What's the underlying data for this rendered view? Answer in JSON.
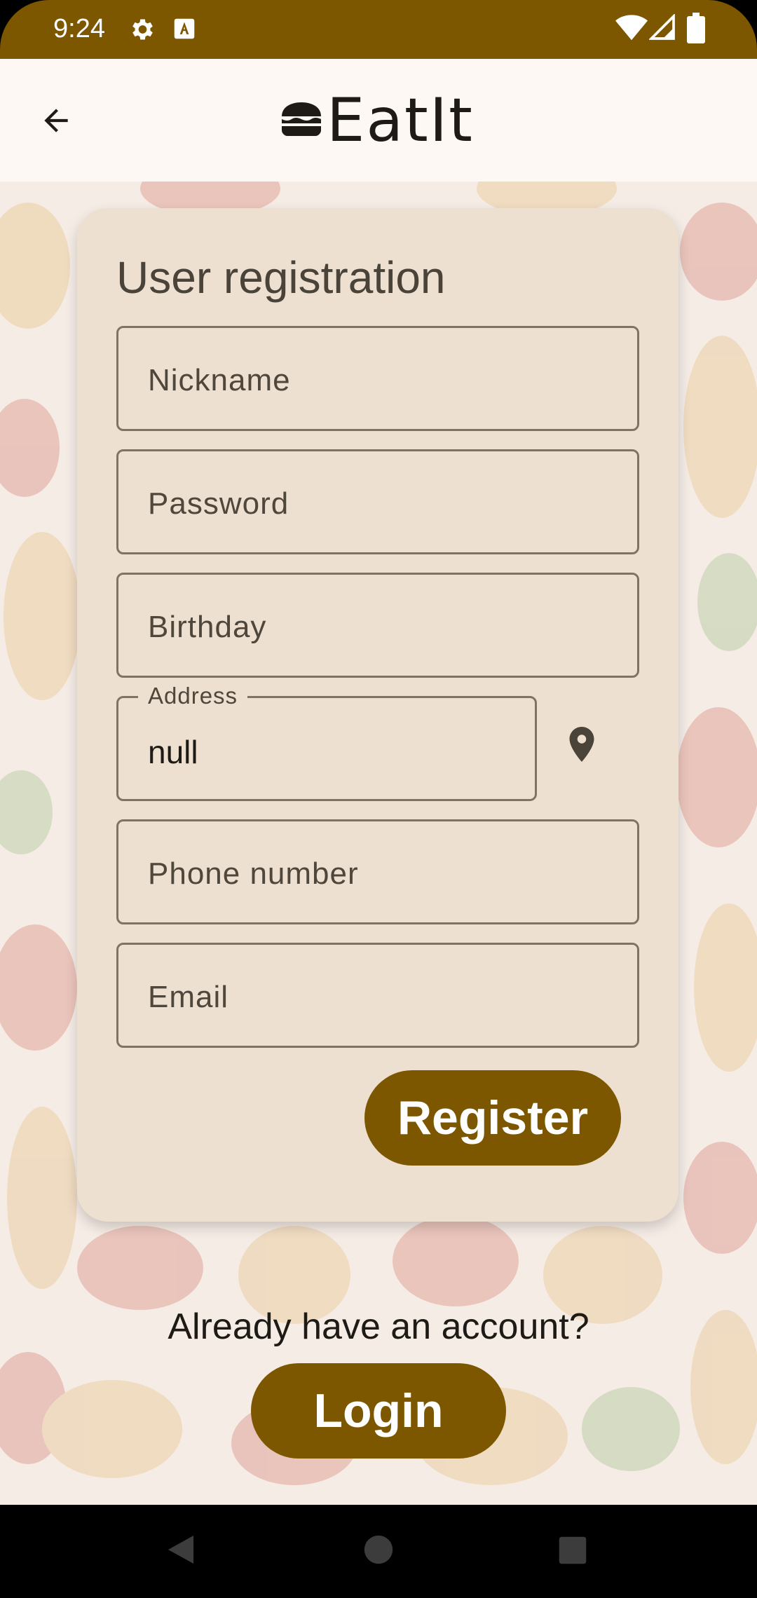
{
  "status_bar": {
    "time": "9:24",
    "icons": [
      "settings-icon",
      "font-icon",
      "wifi-icon",
      "signal-icon",
      "battery-icon"
    ]
  },
  "app_bar": {
    "back_icon": "arrow-back-icon",
    "logo_icon": "burger-icon",
    "logo_text": "EatIt"
  },
  "form": {
    "title": "User registration",
    "fields": {
      "nickname": {
        "placeholder": "Nickname"
      },
      "password": {
        "placeholder": "Password"
      },
      "birthday": {
        "placeholder": "Birthday"
      },
      "address": {
        "label": "Address",
        "value": "null"
      },
      "phone": {
        "placeholder": "Phone number"
      },
      "email": {
        "placeholder": "Email"
      }
    },
    "location_icon": "location-pin-icon",
    "register_label": "Register"
  },
  "footer": {
    "prompt": "Already have an account?",
    "login_label": "Login"
  },
  "nav_bar": {
    "icons": [
      "back-triangle-icon",
      "home-circle-icon",
      "recents-square-icon"
    ]
  },
  "colors": {
    "primary": "#7d5700",
    "app_bar_bg": "#fef8f4",
    "card_bg": "#ede0d0",
    "outline": "#7d7367"
  }
}
